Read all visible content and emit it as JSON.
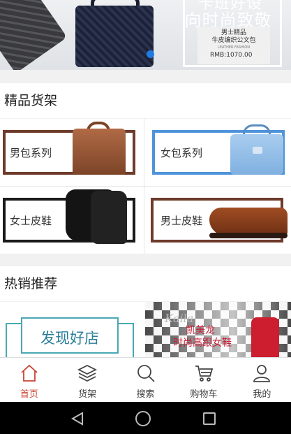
{
  "banner": {
    "headline_top": "卡班好设",
    "headline": "向时尚致敬",
    "product_line1": "男士精品",
    "product_line2": "牛皮编织公文包",
    "product_sub": "LEATHER FASHION",
    "price": "RMB:1070.00"
  },
  "sections": {
    "shelf_title": "精品货架",
    "hot_title": "热销推荐"
  },
  "categories": [
    {
      "label": "男包系列",
      "frame_color": "#6e3b2b"
    },
    {
      "label": "女包系列",
      "frame_color": "#4f93db"
    },
    {
      "label": "女士皮鞋",
      "frame_color": "#1a1a1a"
    },
    {
      "label": "男士皮鞋",
      "frame_color": "#6e3b2b"
    }
  ],
  "hot": {
    "left_text": "发现好店",
    "right_script": "Kaila",
    "right_line1": "凯美龙",
    "right_line2": "时尚高跟女鞋"
  },
  "tabs": [
    {
      "label": "首页",
      "icon": "home-icon",
      "active": true
    },
    {
      "label": "货架",
      "icon": "layers-icon",
      "active": false
    },
    {
      "label": "搜索",
      "icon": "search-icon",
      "active": false
    },
    {
      "label": "购物车",
      "icon": "cart-icon",
      "active": false
    },
    {
      "label": "我的",
      "icon": "user-icon",
      "active": false
    }
  ],
  "colors": {
    "accent": "#c94434",
    "teal": "#49a8b5",
    "promo_red": "#c71e36"
  }
}
